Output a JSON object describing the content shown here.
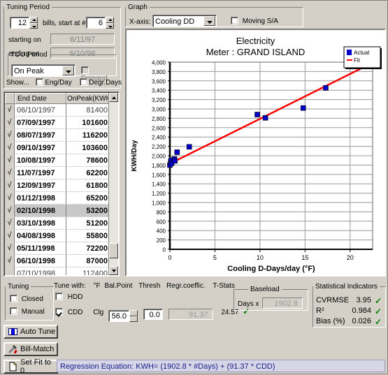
{
  "tuning_period": {
    "legend": "Tuning Period",
    "bills_count": "12",
    "bills_label": "bills, start at #",
    "start_at": "6",
    "starting_label": "starting on",
    "starting_value": "6/11/97",
    "ending_label": "ending on",
    "ending_value": "6/10/98"
  },
  "tou_period": {
    "legend": "TOU Period",
    "selected": "On Peak",
    "options": [
      "On Peak"
    ],
    "demand_label": "Demand",
    "demand_checked": false
  },
  "show_row": {
    "label": "Show...",
    "eng_day_label": "Eng/Day",
    "eng_day_checked": false,
    "degr_days_label": "Degr.Days",
    "degr_days_checked": false
  },
  "table": {
    "columns": [
      "End Date",
      "OnPeak(KWH)"
    ],
    "check_glyph": "√",
    "rows": [
      {
        "check": true,
        "date": "06/10/1997",
        "value": "81400",
        "style": "grey"
      },
      {
        "check": true,
        "date": "07/09/1997",
        "value": "101600",
        "style": "bold"
      },
      {
        "check": true,
        "date": "08/07/1997",
        "value": "116200",
        "style": "bold"
      },
      {
        "check": true,
        "date": "09/10/1997",
        "value": "103600",
        "style": "bold"
      },
      {
        "check": true,
        "date": "10/08/1997",
        "value": "78600",
        "style": "bold"
      },
      {
        "check": true,
        "date": "11/07/1997",
        "value": "62200",
        "style": "bold"
      },
      {
        "check": true,
        "date": "12/09/1997",
        "value": "61800",
        "style": "bold"
      },
      {
        "check": true,
        "date": "01/12/1998",
        "value": "65200",
        "style": "bold"
      },
      {
        "check": true,
        "date": "02/10/1998",
        "value": "53200",
        "style": "bold hi"
      },
      {
        "check": true,
        "date": "03/10/1998",
        "value": "51200",
        "style": "bold"
      },
      {
        "check": true,
        "date": "04/08/1998",
        "value": "55800",
        "style": "bold"
      },
      {
        "check": true,
        "date": "05/11/1998",
        "value": "72200",
        "style": "bold"
      },
      {
        "check": true,
        "date": "06/10/1998",
        "value": "87000",
        "style": "bold"
      },
      {
        "check": false,
        "date": "07/10/1998",
        "value": "112400",
        "style": "grey"
      }
    ]
  },
  "graph_group": {
    "legend": "Graph",
    "xaxis_label": "X-axis:",
    "xaxis_selected": "Cooling DD",
    "moving_sa_label": "Moving S/A",
    "moving_sa_checked": false
  },
  "chart_data": {
    "type": "scatter",
    "title": "Electricity",
    "subtitle": "Meter : GRAND ISLAND",
    "xlabel": "Cooling D-Days/day (°F)",
    "ylabel": "KWH/Day",
    "xlim": [
      0,
      22.5
    ],
    "ylim": [
      0,
      4000
    ],
    "xticks": [
      0,
      5,
      10,
      15,
      20
    ],
    "yticks": [
      0,
      200,
      400,
      600,
      800,
      1000,
      1200,
      1400,
      1600,
      1800,
      2000,
      2200,
      2400,
      2600,
      2800,
      3000,
      3200,
      3400,
      3600,
      3800,
      4000
    ],
    "ytick_labels": [
      "0",
      "200",
      "400",
      "600",
      "800",
      "1,000",
      "1,200",
      "1,400",
      "1,600",
      "1,800",
      "2,000",
      "2,200",
      "2,400",
      "2,600",
      "2,800",
      "3,000",
      "3,200",
      "3,400",
      "3,600",
      "3,800",
      "4,000"
    ],
    "grid": true,
    "legend_position": "top-right",
    "series": [
      {
        "name": "Actual",
        "type": "scatter",
        "color": "#0000c8",
        "marker": "square",
        "points": [
          {
            "x": 0.0,
            "y": 1800
          },
          {
            "x": 0.1,
            "y": 1870
          },
          {
            "x": 0.15,
            "y": 1900
          },
          {
            "x": 0.2,
            "y": 1840
          },
          {
            "x": 0.5,
            "y": 1930
          },
          {
            "x": 0.55,
            "y": 1890
          },
          {
            "x": 0.8,
            "y": 2075
          },
          {
            "x": 2.15,
            "y": 2190
          },
          {
            "x": 9.7,
            "y": 2880
          },
          {
            "x": 10.6,
            "y": 2810
          },
          {
            "x": 14.8,
            "y": 3020
          },
          {
            "x": 17.3,
            "y": 3450
          },
          {
            "x": 21.9,
            "y": 3940
          }
        ]
      },
      {
        "name": "Fit",
        "type": "line",
        "color": "#ff0000",
        "line": [
          {
            "x": 0,
            "y": 1830
          },
          {
            "x": 22.0,
            "y": 3940
          }
        ]
      }
    ]
  },
  "tuning_group": {
    "legend": "Tuning",
    "closed_label": "Closed",
    "closed_checked": false,
    "manual_label": "Manual",
    "manual_checked": false
  },
  "tune_with": {
    "header": "Tune with:",
    "col_f": "°F",
    "col_balpoint": "Bal.Point",
    "col_thresh": "Thresh",
    "col_regr": "Regr.coeffic.",
    "col_tstats": "T-Stats",
    "hdd_label": "HDD",
    "hdd_checked": false,
    "cdd_label": "CDD",
    "cdd_checked": true,
    "clg_label": "Clg",
    "clg_value": "56.0",
    "thresh_value": "0.0",
    "regr_value": "91.37",
    "tstat_value": "24.57",
    "tstat_ok": "✓"
  },
  "baseload": {
    "legend": "Baseload",
    "days_label": "Days x",
    "value": "1902.8"
  },
  "statistics": {
    "legend": "Statistical Indicators",
    "rows": [
      {
        "label": "CVRMSE",
        "value": "3.95",
        "ok": "✓"
      },
      {
        "label": "R²",
        "value": "0.984",
        "ok": "✓"
      },
      {
        "label": "Bias (%)",
        "value": "0.026",
        "ok": "✓"
      }
    ]
  },
  "buttons": {
    "auto_tune": "Auto Tune",
    "bill_match": "Bill-Match",
    "set_fit_to_0": "Set Fit to 0"
  },
  "equation": {
    "text": "Regression Equation: KWH= (1902.8 * #Days) + (91.37 * CDD)"
  }
}
